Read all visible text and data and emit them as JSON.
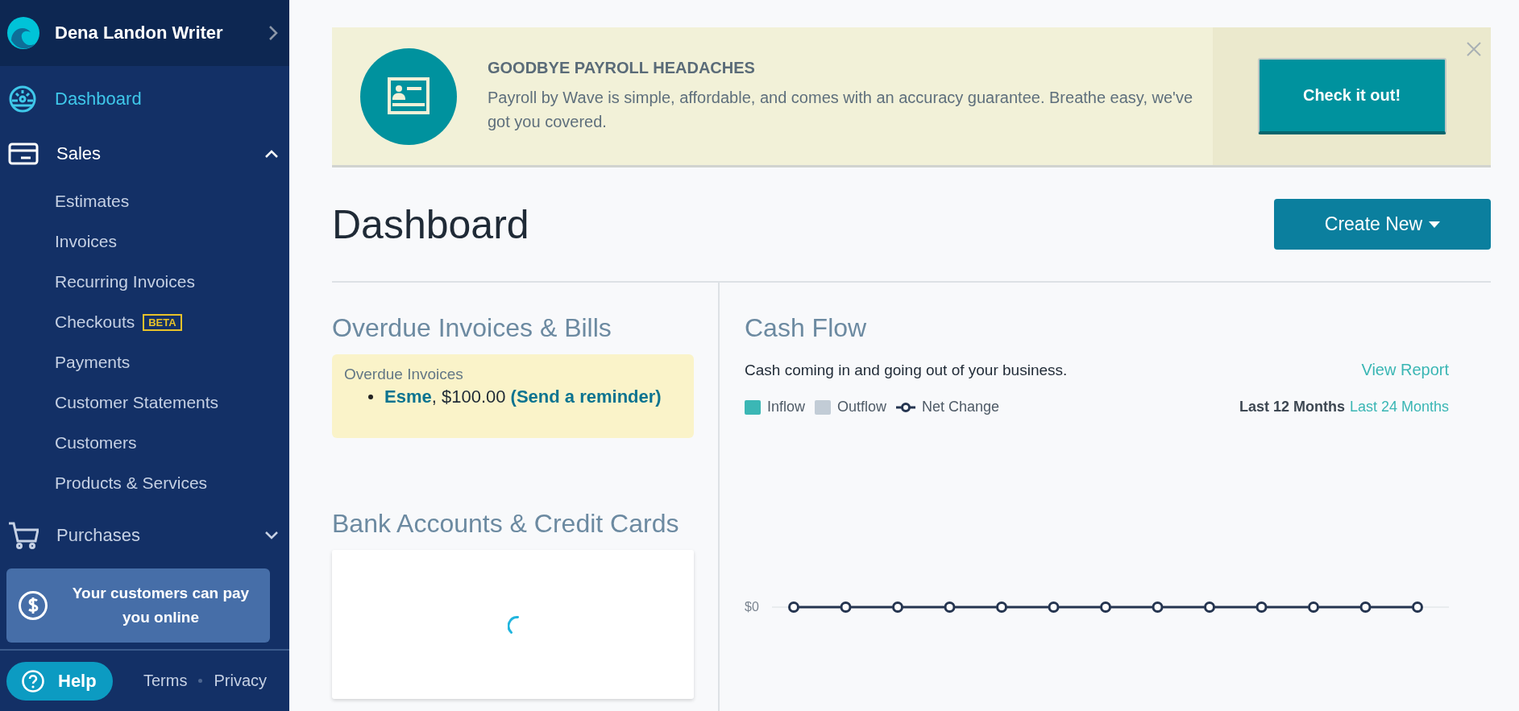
{
  "sidebar": {
    "account": {
      "name": "Dena Landon Writer"
    },
    "nav": [
      {
        "label": "Dashboard",
        "kind": "dashboard",
        "selected": true
      },
      {
        "label": "Sales",
        "kind": "sales",
        "selected": false,
        "expanded": true,
        "children": [
          {
            "label": "Estimates"
          },
          {
            "label": "Invoices"
          },
          {
            "label": "Recurring Invoices"
          },
          {
            "label": "Checkouts",
            "badge": "BETA"
          },
          {
            "label": "Payments"
          },
          {
            "label": "Customer Statements"
          },
          {
            "label": "Customers"
          },
          {
            "label": "Products & Services"
          }
        ]
      },
      {
        "label": "Purchases",
        "kind": "purchases",
        "selected": false,
        "expanded": false
      }
    ],
    "promo": {
      "text": "Your customers can pay you online"
    },
    "help": {
      "label": "Help"
    },
    "links": [
      {
        "label": "Terms"
      },
      {
        "label": "Privacy"
      }
    ]
  },
  "banner": {
    "title": "GOODBYE PAYROLL HEADACHES",
    "text": "Payroll by Wave is simple, affordable, and comes with an accuracy guarantee. Breathe easy, we've got you covered.",
    "button": "Check it out!"
  },
  "page": {
    "title": "Dashboard",
    "create_button": "Create New"
  },
  "overdue": {
    "heading": "Overdue Invoices & Bills",
    "box_title": "Overdue Invoices",
    "items": [
      {
        "customer": "Esme",
        "amount": ", $100.00",
        "action": "(Send a reminder)"
      }
    ]
  },
  "bank": {
    "heading": "Bank Accounts & Credit Cards",
    "loading": true
  },
  "cash_flow": {
    "heading": "Cash Flow",
    "subtitle": "Cash coming in and going out of your business.",
    "report_link": "View Report",
    "legend": [
      {
        "label": "Inflow",
        "kind": "swatch",
        "color": "#3bb7b5"
      },
      {
        "label": "Outflow",
        "kind": "swatch",
        "color": "#c2ccd6"
      },
      {
        "label": "Net Change",
        "kind": "line",
        "color": "#253550"
      }
    ],
    "periods": [
      {
        "label": "Last 12 Months",
        "selected": true
      },
      {
        "label": "Last 24 Months",
        "selected": false
      }
    ],
    "y_label": "$0"
  }
}
